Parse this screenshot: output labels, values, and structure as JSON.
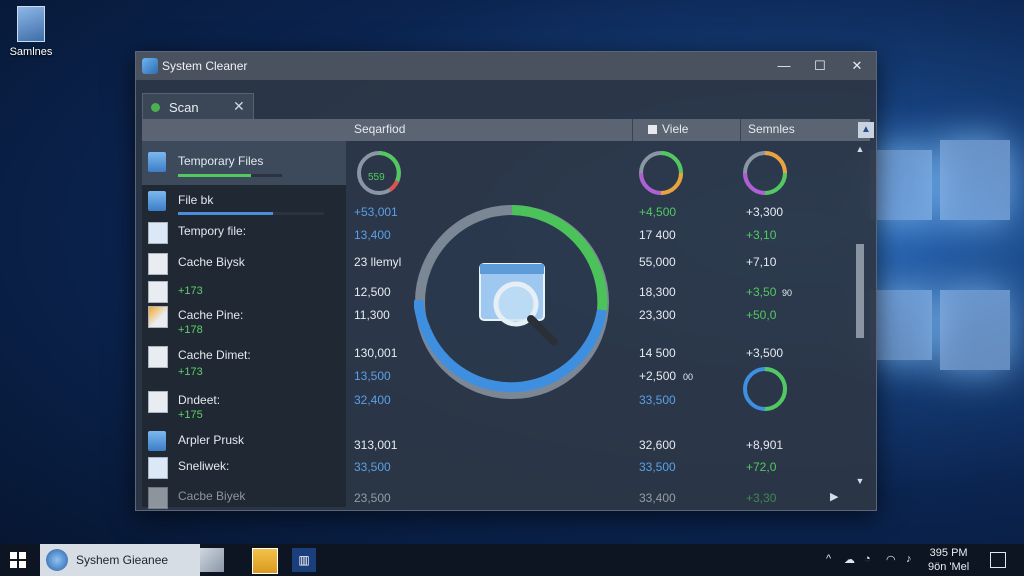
{
  "desktop": {
    "icon_label": "Samlnes"
  },
  "window": {
    "title": "System Cleaner",
    "minimize": "—",
    "maximize": "☐",
    "close": "✕"
  },
  "tab": {
    "label": "Scan",
    "close": "✕"
  },
  "columns": {
    "c1": "Seqarfiod",
    "c2": "Viele",
    "c3": "Semnles",
    "sort": "▲"
  },
  "items": [
    {
      "label": "Temporary Files",
      "icon": "folder-icon"
    },
    {
      "label": "File bk",
      "icon": "folder-icon"
    },
    {
      "label": "Tempory file:",
      "icon": "file-icon"
    },
    {
      "label": "Cache Biysk",
      "icon": "file-icon"
    },
    {
      "label": "",
      "sub": "+173",
      "icon": "file-icon"
    },
    {
      "label": "Cache Pine:",
      "sub": "+178",
      "icon": "file-icon"
    },
    {
      "label": "Cache Dimet:",
      "sub": "+173",
      "icon": "file-icon"
    },
    {
      "label": "Dndeet:",
      "sub": "+175",
      "icon": "file-icon"
    },
    {
      "label": "Arpler Prusk",
      "icon": "folder-icon"
    },
    {
      "label": "Sneliwek:",
      "icon": "file-icon"
    },
    {
      "label": "Cacbe Biyek",
      "icon": "file-icon"
    }
  ],
  "progress": {
    "temporary_files": 0.7,
    "file_bk": 0.65
  },
  "col1": [
    "559",
    "+53,001",
    "13,400",
    "23 llemyl",
    "12,500",
    "11,300",
    "130,001",
    "13,500",
    "32,400",
    "313,001",
    "33,500",
    "23,500"
  ],
  "col2": [
    "+4,500",
    "17 400",
    "55,000",
    "18,300",
    "23,300",
    "14 500",
    "+2,500",
    "33,500",
    "32,600",
    "33,500",
    "33,400"
  ],
  "col2_suffix": "00",
  "col3": [
    "+3,300",
    "+3,10",
    "+7,10",
    "+3,50",
    "+50,0",
    "+3,500",
    "+8,901",
    "+72,0",
    "+3,30"
  ],
  "col3_suffix": "90",
  "colors": {
    "accent_green": "#52c95e",
    "accent_blue": "#5aa0e6",
    "ring_gray": "#8b96a5"
  },
  "taskbar": {
    "app_label": "Syshem Gieanee",
    "time": "395 PM",
    "date": "9ön 'Mel"
  }
}
